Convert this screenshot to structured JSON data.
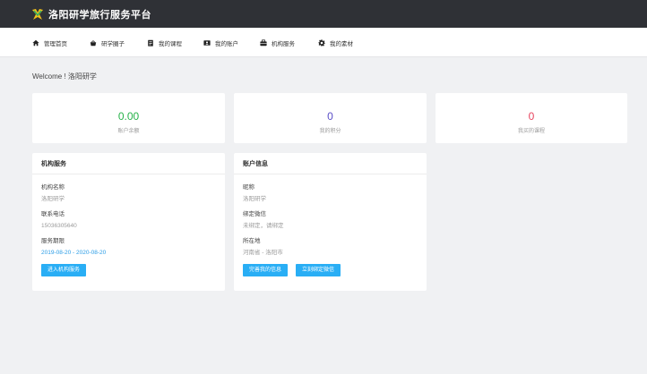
{
  "app": {
    "title": "洛阳研学旅行服务平台"
  },
  "nav": [
    {
      "label": "管理首页",
      "icon": "home-icon"
    },
    {
      "label": "研学圈子",
      "icon": "circle-icon"
    },
    {
      "label": "我的课程",
      "icon": "course-icon"
    },
    {
      "label": "我的账户",
      "icon": "account-icon"
    },
    {
      "label": "机构服务",
      "icon": "briefcase-icon"
    },
    {
      "label": "我的素材",
      "icon": "gear-icon"
    }
  ],
  "welcome": "Welcome ! 洛阳研学",
  "stats": [
    {
      "value": "0.00",
      "label": "账户余额",
      "color": "#27b24a"
    },
    {
      "value": "0",
      "label": "我的积分",
      "color": "#5b4fc8"
    },
    {
      "value": "0",
      "label": "我买的课程",
      "color": "#e8455f"
    }
  ],
  "org_panel": {
    "title": "机构服务",
    "fields": [
      {
        "label": "机构名称",
        "value": "洛阳研学"
      },
      {
        "label": "联系电话",
        "value": "15036305640"
      },
      {
        "label": "服务期限",
        "value": "2019-08-20 - 2020-08-20"
      }
    ],
    "buttons": [
      "进入机构服务"
    ]
  },
  "account_panel": {
    "title": "账户信息",
    "fields": [
      {
        "label": "昵称",
        "value": "洛阳研学"
      },
      {
        "label": "绑定微信",
        "value": "未绑定，请绑定"
      },
      {
        "label": "所在地",
        "value": "河南省 - 洛阳市"
      }
    ],
    "buttons": [
      "完善我的信息",
      "立刻绑定微信"
    ]
  }
}
